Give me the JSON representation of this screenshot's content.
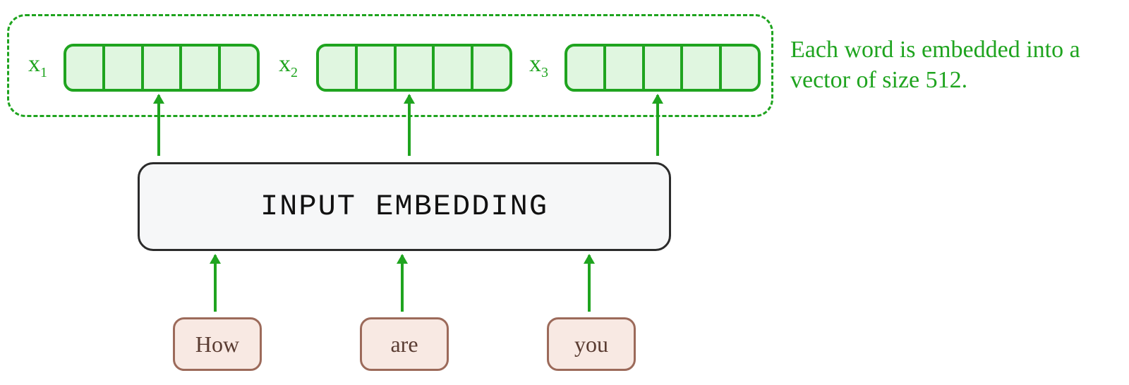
{
  "caption": "Each word is embedded into a vector of size 512.",
  "embedding_box_label": "INPUT EMBEDDING",
  "vectors": [
    {
      "sym": "x",
      "sub": "1"
    },
    {
      "sym": "x",
      "sub": "2"
    },
    {
      "sym": "x",
      "sub": "3"
    }
  ],
  "words": [
    "How",
    "are",
    "you"
  ],
  "vector_cells": 5,
  "colors": {
    "green": "#1fa41f",
    "green_fill": "#e0f6e0",
    "word_fill": "#f8e9e3",
    "word_border": "#9c6a5a",
    "box_fill": "#f6f7f8"
  }
}
